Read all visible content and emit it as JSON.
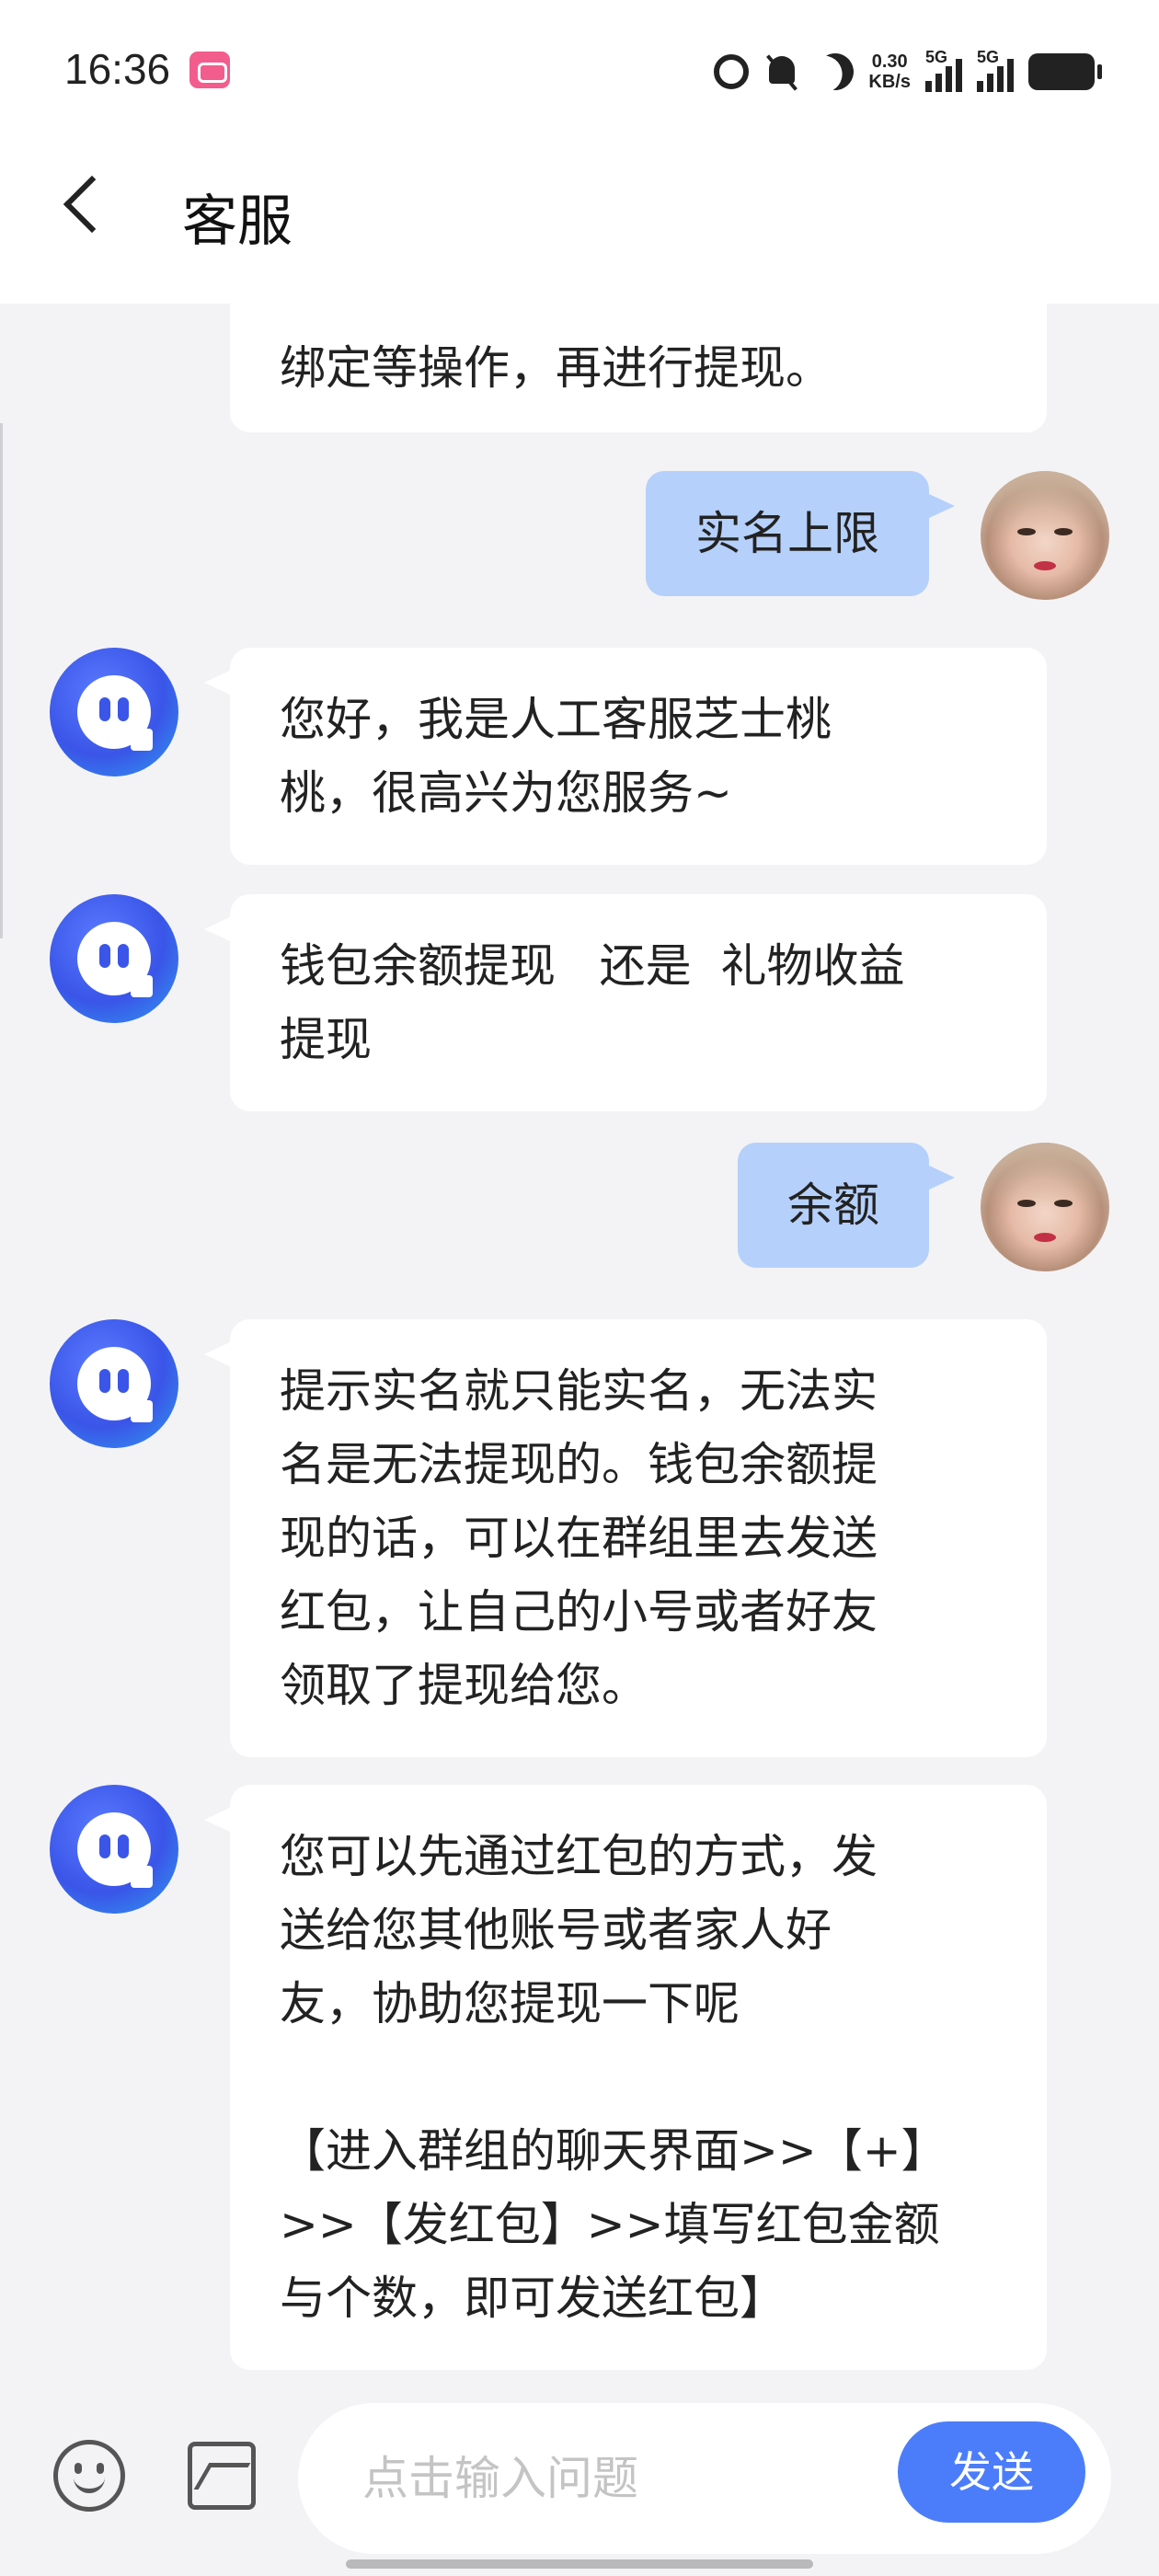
{
  "status_bar": {
    "time": "16:36",
    "net_speed_value": "0.30",
    "net_speed_unit": "KB/s",
    "signal1_label": "5G",
    "signal2_label": "5G",
    "icons": [
      "alarm-icon",
      "bell-off-icon",
      "moon-icon",
      "signal-icon",
      "battery-icon"
    ]
  },
  "header": {
    "title": "客服",
    "back_icon": "back-arrow-icon"
  },
  "messages": [
    {
      "from": "bot",
      "text": "绑定等操作，再进行提现。",
      "partial": true
    },
    {
      "from": "user",
      "text": "实名上限"
    },
    {
      "from": "bot",
      "text": "您好，我是人工客服芝士桃\n桃，很高兴为您服务~"
    },
    {
      "from": "bot",
      "text": "钱包余额提现   还是  礼物收益\n提现"
    },
    {
      "from": "user",
      "text": "余额"
    },
    {
      "from": "bot",
      "text": "提示实名就只能实名，无法实\n名是无法提现的。钱包余额提\n现的话，可以在群组里去发送\n红包，让自己的小号或者好友\n领取了提现给您。"
    },
    {
      "from": "bot",
      "text": "您可以先通过红包的方式，发\n送给您其他账号或者家人好\n友，协助您提现一下呢\n\n【进入群组的聊天界面>>【+】\n>>【发红包】>>填写红包金额\n与个数，即可发送红包】"
    }
  ],
  "input_bar": {
    "placeholder": "点击输入问题",
    "value": "",
    "send_label": "发送",
    "send_color": "#4b7dfb"
  },
  "colors": {
    "user_bubble": "#b5d0fb",
    "bot_bubble": "#ffffff",
    "background": "#f3f3f5"
  }
}
